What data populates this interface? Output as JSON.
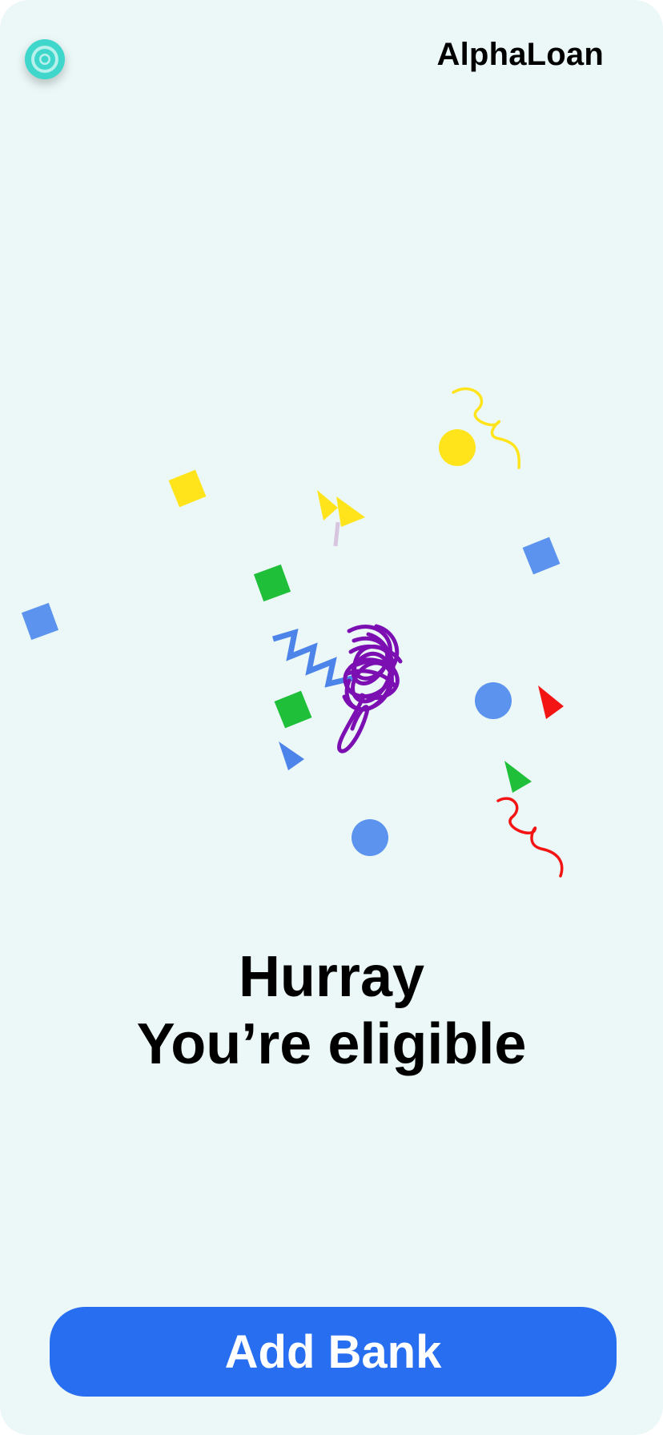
{
  "header": {
    "brand": "AlphaLoan",
    "logo_icon": "target-icon"
  },
  "main": {
    "headline_line1": "Hurray",
    "headline_line2": "You’re eligible",
    "illustration": "confetti-illustration"
  },
  "actions": {
    "add_bank_label": "Add Bank"
  },
  "colors": {
    "background": "#ebf8f7",
    "primary": "#276ef1",
    "logo": "#3fd6cc",
    "confetti_yellow": "#ffe41c",
    "confetti_blue": "#5b93ef",
    "confetti_green": "#1fbf3a",
    "confetti_red": "#f31414",
    "confetti_purple": "#7b0fb2"
  }
}
